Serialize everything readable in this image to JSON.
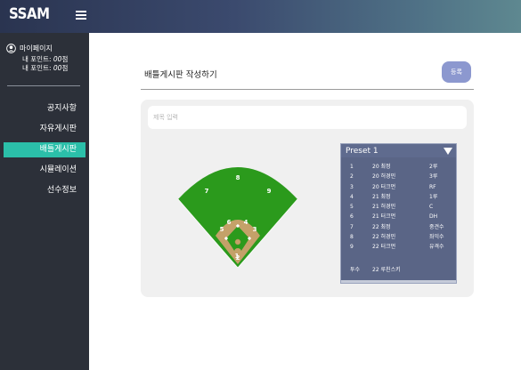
{
  "app": {
    "logo": "SSAM"
  },
  "sidebar": {
    "profile_name": "마이페이지",
    "points_label_1": "내 포인트: ",
    "points_value_1": "00",
    "points_unit_1": "점",
    "points_label_2": "내 포인트: ",
    "points_value_2": "00",
    "points_unit_2": "점",
    "items": [
      {
        "label": "공지사항",
        "active": false
      },
      {
        "label": "자유게시판",
        "active": false
      },
      {
        "label": "배틀게시판",
        "active": true
      },
      {
        "label": "시뮬레이션",
        "active": false
      },
      {
        "label": "선수정보",
        "active": false
      }
    ]
  },
  "main": {
    "page_title": "배틀게시판 작성하기",
    "register_label": "등록",
    "title_placeholder": "제목 입력",
    "title_value": ""
  },
  "field": {
    "positions": [
      "1",
      "2",
      "3",
      "4",
      "5",
      "6",
      "7",
      "8",
      "9"
    ],
    "colors": {
      "grass": "#2b9a1c",
      "infield": "#c4a169",
      "lines": "#ffffff"
    }
  },
  "preset": {
    "name": "Preset 1",
    "lineup": [
      {
        "order": "1",
        "player": "20 최정",
        "pos": "2루"
      },
      {
        "order": "2",
        "player": "20 허경민",
        "pos": "3루"
      },
      {
        "order": "3",
        "player": "20 터크먼",
        "pos": "RF"
      },
      {
        "order": "4",
        "player": "21 최정",
        "pos": "1루"
      },
      {
        "order": "5",
        "player": "21 허경민",
        "pos": "C"
      },
      {
        "order": "6",
        "player": "21 터크먼",
        "pos": "DH"
      },
      {
        "order": "7",
        "player": "22 최정",
        "pos": "중견수"
      },
      {
        "order": "8",
        "player": "22 허경민",
        "pos": "좌익수"
      },
      {
        "order": "9",
        "player": "22 터크먼",
        "pos": "유격수"
      }
    ],
    "pitcher_label": "투수",
    "pitcher": "22 루친스키"
  }
}
